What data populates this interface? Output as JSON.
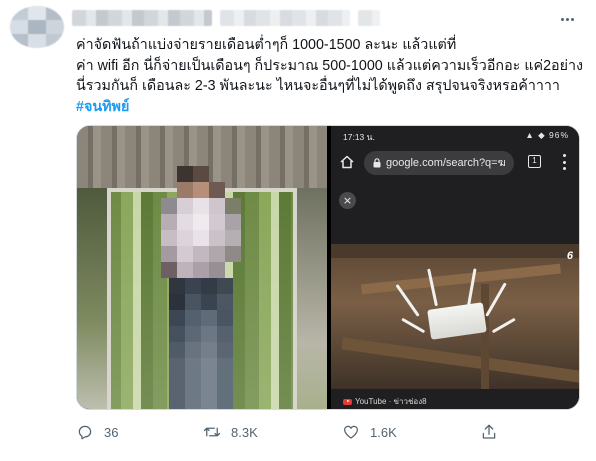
{
  "tweet": {
    "text_lines": [
      "ค่าจัดฟันถ้าแบ่งจ่ายรายเดือนต่ำๆก็ 1000-1500 ละนะ แล้วแต่ที่",
      "ค่า wifi อีก นี่ก็จ่ายเป็นเดือนๆ ก็ประมาณ 500-1000 แล้วแต่ความเร็วอีกอะ แค่2อย่าง",
      "นี่รวมกันก็ เดือนละ 2-3 พันละนะ ไหนจะอื่นๆที่ไม่ได้พูดถึง สรุปจนจริงหรอค้าาาา"
    ],
    "hashtag": "#จนทิพย์"
  },
  "screenshot": {
    "time": "17:13 น.",
    "status_icons": "▲ ◆ 96%",
    "url": "google.com/search?q=ฆ",
    "tab_count": "1",
    "close_glyph": "×",
    "channel_logo": "6",
    "caption": "YouTube · ข่าวช่อง8"
  },
  "actions": {
    "reply_count": "36",
    "retweet_count": "8.3K",
    "like_count": "1.6K"
  },
  "colors": {
    "accent": "#1d9bf0",
    "icon_gray": "#536471",
    "text": "#0f1419"
  },
  "icons": [
    "more-icon",
    "home-icon",
    "lock-icon",
    "menu-icon",
    "close-icon",
    "youtube-icon",
    "reply-icon",
    "retweet-icon",
    "like-icon",
    "share-icon"
  ]
}
